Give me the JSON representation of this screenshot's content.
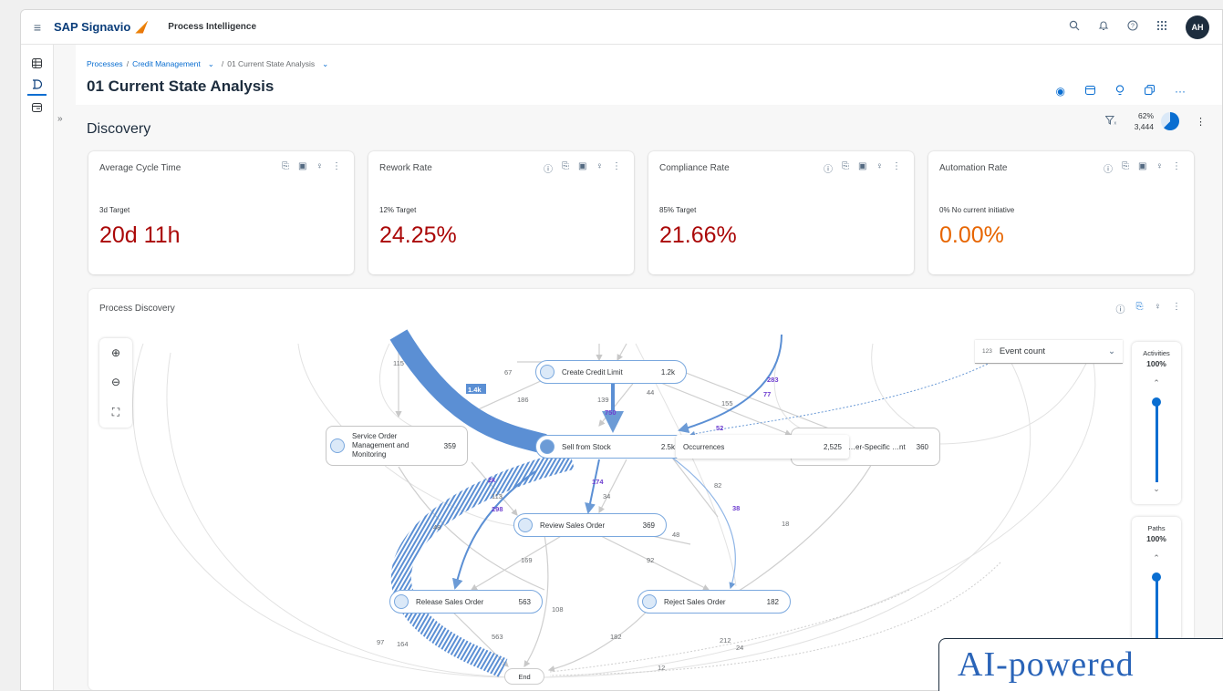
{
  "shell": {
    "brand": "SAP Signavio",
    "product": "Process Intelligence",
    "avatar": "AH",
    "icons": [
      "menu-icon",
      "search-icon",
      "bell-icon",
      "help-icon",
      "grid-icon"
    ]
  },
  "breadcrumb": {
    "items": [
      "Processes",
      "Credit Management",
      "01 Current State Analysis"
    ]
  },
  "page": {
    "title": "01 Current State Analysis"
  },
  "discovery": {
    "title": "Discovery",
    "coverage_pct": "62%",
    "case_count": "3,444",
    "coverage_fraction": 0.62
  },
  "kpis": [
    {
      "title": "Average Cycle Time",
      "target": "3d Target",
      "value": "20d 11h",
      "color": "#aa0808"
    },
    {
      "title": "Rework Rate",
      "target": "12% Target",
      "value": "24.25%",
      "color": "#aa0808"
    },
    {
      "title": "Compliance Rate",
      "target": "85% Target",
      "value": "21.66%",
      "color": "#aa0808"
    },
    {
      "title": "Automation Rate",
      "target": "0% No current initiative",
      "value": "0.00%",
      "color": "#e76500"
    }
  ],
  "process_discovery": {
    "title": "Process Discovery",
    "metric_select": {
      "prefix": "123",
      "value": "Event count"
    },
    "activities_slider": {
      "label": "Activities",
      "value": "100%"
    },
    "paths_slider": {
      "label": "Paths",
      "value": "100%"
    },
    "tooltip": {
      "label": "Occurrences",
      "value": "2,525"
    },
    "nodes": {
      "create_credit_limit": {
        "label": "Create Credit Limit",
        "count": "1.2k"
      },
      "service_order": {
        "label": "Service Order Management and Monitoring",
        "count": "359"
      },
      "sell_from_stock": {
        "label": "Sell from Stock",
        "count": "2.5k"
      },
      "order_specific": {
        "label": "…er-Specific …nt",
        "count": "360"
      },
      "review_sales_order": {
        "label": "Review Sales Order",
        "count": "369"
      },
      "release_sales_order": {
        "label": "Release Sales Order",
        "count": "563"
      },
      "reject_sales_order": {
        "label": "Reject Sales Order",
        "count": "182"
      },
      "end": {
        "label": "End"
      }
    },
    "edge_labels": {
      "e115": "115",
      "e67": "67",
      "e1_4k": "1.4k",
      "e186": "186",
      "e139": "139",
      "e44": "44",
      "e283": "283",
      "e77": "77",
      "e155": "155",
      "e750": "750",
      "e52": "52",
      "e2k": "2k",
      "e174": "174",
      "e82": "82",
      "e113": "113",
      "e34": "34",
      "e298": "298",
      "e38": "38",
      "e48a": "48",
      "e48b": "48",
      "e18": "18",
      "e169": "169",
      "e92": "92",
      "e108": "108",
      "e563": "563",
      "e182": "182",
      "e212": "212",
      "e24": "24",
      "e12": "12",
      "e97": "97",
      "e164": "164"
    }
  },
  "watermark": "AI-powered"
}
